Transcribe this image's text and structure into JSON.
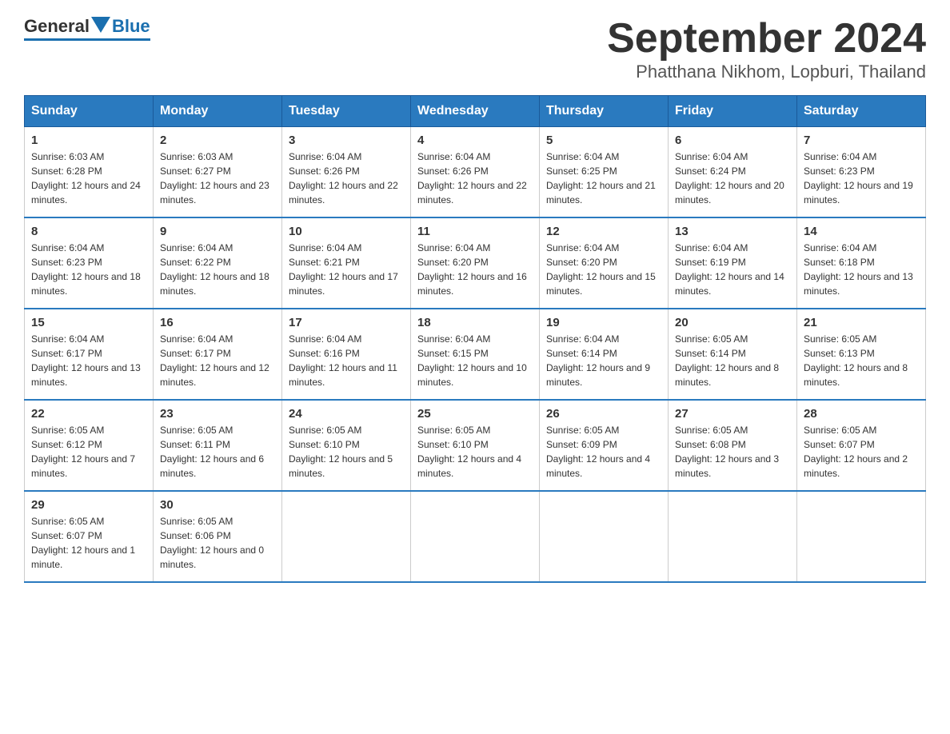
{
  "header": {
    "logo_general": "General",
    "logo_blue": "Blue",
    "month_title": "September 2024",
    "location": "Phatthana Nikhom, Lopburi, Thailand"
  },
  "days_of_week": [
    "Sunday",
    "Monday",
    "Tuesday",
    "Wednesday",
    "Thursday",
    "Friday",
    "Saturday"
  ],
  "weeks": [
    [
      {
        "day": "1",
        "sunrise": "6:03 AM",
        "sunset": "6:28 PM",
        "daylight": "12 hours and 24 minutes."
      },
      {
        "day": "2",
        "sunrise": "6:03 AM",
        "sunset": "6:27 PM",
        "daylight": "12 hours and 23 minutes."
      },
      {
        "day": "3",
        "sunrise": "6:04 AM",
        "sunset": "6:26 PM",
        "daylight": "12 hours and 22 minutes."
      },
      {
        "day": "4",
        "sunrise": "6:04 AM",
        "sunset": "6:26 PM",
        "daylight": "12 hours and 22 minutes."
      },
      {
        "day": "5",
        "sunrise": "6:04 AM",
        "sunset": "6:25 PM",
        "daylight": "12 hours and 21 minutes."
      },
      {
        "day": "6",
        "sunrise": "6:04 AM",
        "sunset": "6:24 PM",
        "daylight": "12 hours and 20 minutes."
      },
      {
        "day": "7",
        "sunrise": "6:04 AM",
        "sunset": "6:23 PM",
        "daylight": "12 hours and 19 minutes."
      }
    ],
    [
      {
        "day": "8",
        "sunrise": "6:04 AM",
        "sunset": "6:23 PM",
        "daylight": "12 hours and 18 minutes."
      },
      {
        "day": "9",
        "sunrise": "6:04 AM",
        "sunset": "6:22 PM",
        "daylight": "12 hours and 18 minutes."
      },
      {
        "day": "10",
        "sunrise": "6:04 AM",
        "sunset": "6:21 PM",
        "daylight": "12 hours and 17 minutes."
      },
      {
        "day": "11",
        "sunrise": "6:04 AM",
        "sunset": "6:20 PM",
        "daylight": "12 hours and 16 minutes."
      },
      {
        "day": "12",
        "sunrise": "6:04 AM",
        "sunset": "6:20 PM",
        "daylight": "12 hours and 15 minutes."
      },
      {
        "day": "13",
        "sunrise": "6:04 AM",
        "sunset": "6:19 PM",
        "daylight": "12 hours and 14 minutes."
      },
      {
        "day": "14",
        "sunrise": "6:04 AM",
        "sunset": "6:18 PM",
        "daylight": "12 hours and 13 minutes."
      }
    ],
    [
      {
        "day": "15",
        "sunrise": "6:04 AM",
        "sunset": "6:17 PM",
        "daylight": "12 hours and 13 minutes."
      },
      {
        "day": "16",
        "sunrise": "6:04 AM",
        "sunset": "6:17 PM",
        "daylight": "12 hours and 12 minutes."
      },
      {
        "day": "17",
        "sunrise": "6:04 AM",
        "sunset": "6:16 PM",
        "daylight": "12 hours and 11 minutes."
      },
      {
        "day": "18",
        "sunrise": "6:04 AM",
        "sunset": "6:15 PM",
        "daylight": "12 hours and 10 minutes."
      },
      {
        "day": "19",
        "sunrise": "6:04 AM",
        "sunset": "6:14 PM",
        "daylight": "12 hours and 9 minutes."
      },
      {
        "day": "20",
        "sunrise": "6:05 AM",
        "sunset": "6:14 PM",
        "daylight": "12 hours and 8 minutes."
      },
      {
        "day": "21",
        "sunrise": "6:05 AM",
        "sunset": "6:13 PM",
        "daylight": "12 hours and 8 minutes."
      }
    ],
    [
      {
        "day": "22",
        "sunrise": "6:05 AM",
        "sunset": "6:12 PM",
        "daylight": "12 hours and 7 minutes."
      },
      {
        "day": "23",
        "sunrise": "6:05 AM",
        "sunset": "6:11 PM",
        "daylight": "12 hours and 6 minutes."
      },
      {
        "day": "24",
        "sunrise": "6:05 AM",
        "sunset": "6:10 PM",
        "daylight": "12 hours and 5 minutes."
      },
      {
        "day": "25",
        "sunrise": "6:05 AM",
        "sunset": "6:10 PM",
        "daylight": "12 hours and 4 minutes."
      },
      {
        "day": "26",
        "sunrise": "6:05 AM",
        "sunset": "6:09 PM",
        "daylight": "12 hours and 4 minutes."
      },
      {
        "day": "27",
        "sunrise": "6:05 AM",
        "sunset": "6:08 PM",
        "daylight": "12 hours and 3 minutes."
      },
      {
        "day": "28",
        "sunrise": "6:05 AM",
        "sunset": "6:07 PM",
        "daylight": "12 hours and 2 minutes."
      }
    ],
    [
      {
        "day": "29",
        "sunrise": "6:05 AM",
        "sunset": "6:07 PM",
        "daylight": "12 hours and 1 minute."
      },
      {
        "day": "30",
        "sunrise": "6:05 AM",
        "sunset": "6:06 PM",
        "daylight": "12 hours and 0 minutes."
      },
      null,
      null,
      null,
      null,
      null
    ]
  ]
}
